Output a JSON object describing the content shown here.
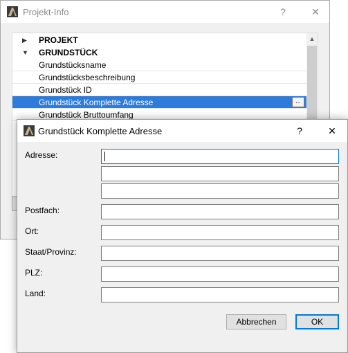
{
  "back_window": {
    "title": "Projekt-Info",
    "help_label": "?",
    "close_label": "✕",
    "tree": {
      "groups": [
        {
          "label": "PROJEKT",
          "expanded": false
        },
        {
          "label": "GRUNDSTÜCK",
          "expanded": true
        }
      ],
      "items": [
        "Grundstücksname",
        "Grundstücksbeschreibung",
        "Grundstück ID",
        "Grundstück Komplette Adresse",
        "Grundstück Bruttoumfang"
      ],
      "selected_index": 3,
      "edit_button_label": "..."
    }
  },
  "dialog": {
    "title": "Grundstück Komplette Adresse",
    "help_label": "?",
    "close_label": "✕",
    "fields": {
      "address_label": "Adresse:",
      "address_lines": [
        "",
        "",
        ""
      ],
      "postfach_label": "Postfach:",
      "postfach_value": "",
      "ort_label": "Ort:",
      "ort_value": "",
      "staat_label": "Staat/Provinz:",
      "staat_value": "",
      "plz_label": "PLZ:",
      "plz_value": "",
      "land_label": "Land:",
      "land_value": ""
    },
    "buttons": {
      "cancel": "Abbrechen",
      "ok": "OK"
    }
  },
  "colors": {
    "selection": "#2f7bd9",
    "focus_border": "#0078d7"
  }
}
